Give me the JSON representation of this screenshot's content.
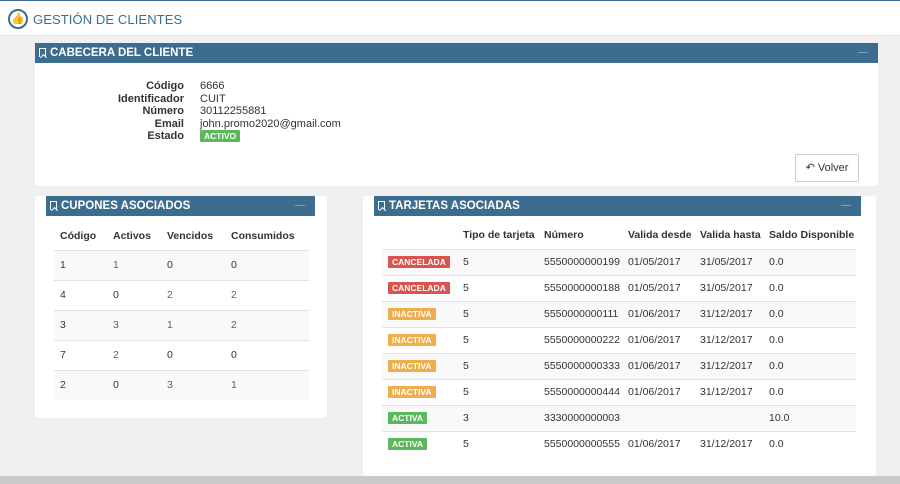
{
  "header": {
    "title": "GESTIÓN DE CLIENTES",
    "logo_icon": "thumbs-up-icon"
  },
  "cliente": {
    "title": "CABECERA DEL CLIENTE",
    "fields": [
      {
        "label": "Código",
        "value": "6666"
      },
      {
        "label": "Identificador",
        "value": "CUIT"
      },
      {
        "label": "Número",
        "value": "30112255881"
      },
      {
        "label": "Email",
        "value": "john.promo2020@gmail.com"
      }
    ],
    "estado_label": "Estado",
    "estado_value": "ACTIVO",
    "volver_label": "Volver"
  },
  "cupones": {
    "title": "CUPONES ASOCIADOS",
    "columns": [
      "Código",
      "Activos",
      "Vencidos",
      "Consumidos"
    ],
    "rows": [
      [
        "1",
        "1",
        "0",
        "0"
      ],
      [
        "4",
        "0",
        "2",
        "2"
      ],
      [
        "3",
        "3",
        "1",
        "2"
      ],
      [
        "7",
        "2",
        "0",
        "0"
      ],
      [
        "2",
        "0",
        "3",
        "1"
      ]
    ]
  },
  "tarjetas": {
    "title": "TARJETAS ASOCIADAS",
    "columns": [
      "",
      "Tipo de tarjeta",
      "Número",
      "Valida desde",
      "Valida hasta",
      "Saldo Disponible"
    ],
    "rows": [
      [
        "CANCELADA",
        "5",
        "5550000000199",
        "01/05/2017",
        "31/05/2017",
        "0.0"
      ],
      [
        "CANCELADA",
        "5",
        "5550000000188",
        "01/05/2017",
        "31/05/2017",
        "0.0"
      ],
      [
        "INACTIVA",
        "5",
        "5550000000111",
        "01/06/2017",
        "31/12/2017",
        "0.0"
      ],
      [
        "INACTIVA",
        "5",
        "5550000000222",
        "01/06/2017",
        "31/12/2017",
        "0.0"
      ],
      [
        "INACTIVA",
        "5",
        "5550000000333",
        "01/06/2017",
        "31/12/2017",
        "0.0"
      ],
      [
        "INACTIVA",
        "5",
        "5550000000444",
        "01/06/2017",
        "31/12/2017",
        "0.0"
      ],
      [
        "ACTIVA",
        "3",
        "3330000000003",
        "",
        "",
        "10.0"
      ],
      [
        "ACTIVA",
        "5",
        "5550000000555",
        "01/06/2017",
        "31/12/2017",
        "0.0"
      ]
    ]
  },
  "colors": {
    "primary": "#3d6d8e",
    "green": "#5cb85c",
    "red": "#d9534f",
    "orange": "#f0ad4e"
  }
}
